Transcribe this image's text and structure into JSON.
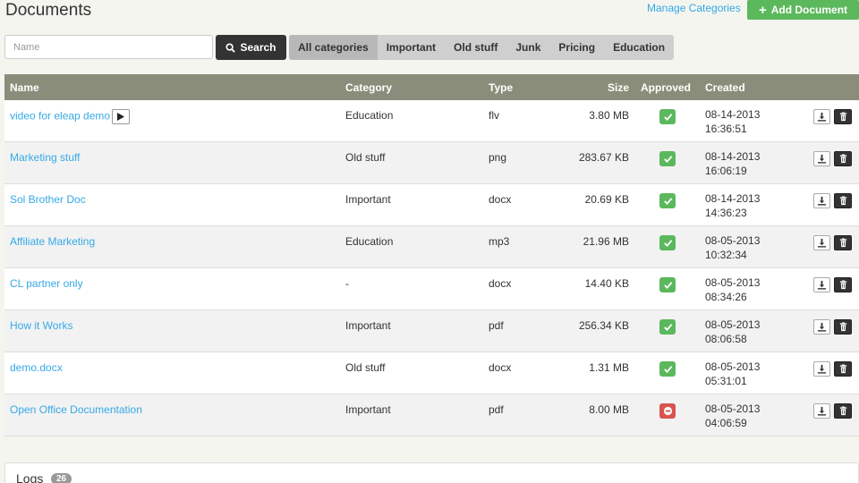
{
  "header": {
    "title": "Documents",
    "manage_link": "Manage Categories",
    "add_button": "Add Document"
  },
  "search": {
    "placeholder": "Name",
    "value": "",
    "button": "Search"
  },
  "categories": [
    {
      "label": "All categories",
      "active": true
    },
    {
      "label": "Important",
      "active": false
    },
    {
      "label": "Old stuff",
      "active": false
    },
    {
      "label": "Junk",
      "active": false
    },
    {
      "label": "Pricing",
      "active": false
    },
    {
      "label": "Education",
      "active": false
    }
  ],
  "table": {
    "columns": {
      "name": "Name",
      "category": "Category",
      "type": "Type",
      "size": "Size",
      "approved": "Approved",
      "created": "Created"
    },
    "rows": [
      {
        "name": "video for eleap demo",
        "category": "Education",
        "type": "flv",
        "size": "3.80 MB",
        "approved": true,
        "date": "08-14-2013",
        "time": "16:36:51",
        "play": true
      },
      {
        "name": "Marketing stuff",
        "category": "Old stuff",
        "type": "png",
        "size": "283.67 KB",
        "approved": true,
        "date": "08-14-2013",
        "time": "16:06:19",
        "play": false
      },
      {
        "name": "Sol Brother Doc",
        "category": "Important",
        "type": "docx",
        "size": "20.69 KB",
        "approved": true,
        "date": "08-14-2013",
        "time": "14:36:23",
        "play": false
      },
      {
        "name": "Affiliate Marketing",
        "category": "Education",
        "type": "mp3",
        "size": "21.96 MB",
        "approved": true,
        "date": "08-05-2013",
        "time": "10:32:34",
        "play": false
      },
      {
        "name": "CL partner only",
        "category": "-",
        "type": "docx",
        "size": "14.40 KB",
        "approved": true,
        "date": "08-05-2013",
        "time": "08:34:26",
        "play": false
      },
      {
        "name": "How it Works",
        "category": "Important",
        "type": "pdf",
        "size": "256.34 KB",
        "approved": true,
        "date": "08-05-2013",
        "time": "08:06:58",
        "play": false
      },
      {
        "name": "demo.docx",
        "category": "Old stuff",
        "type": "docx",
        "size": "1.31 MB",
        "approved": true,
        "date": "08-05-2013",
        "time": "05:31:01",
        "play": false
      },
      {
        "name": "Open Office Documentation",
        "category": "Important",
        "type": "pdf",
        "size": "8.00 MB",
        "approved": false,
        "date": "08-05-2013",
        "time": "04:06:59",
        "play": false
      }
    ]
  },
  "logs": {
    "title": "Logs",
    "count": "26"
  },
  "colors": {
    "accent_green": "#5cb85c",
    "link_blue": "#35a9e6",
    "header_gray": "#8b8d7b",
    "rejected_red": "#d9534f"
  },
  "icons": {
    "add": "plus-icon",
    "search": "magnifier-icon",
    "play": "play-icon",
    "approved": "check-icon",
    "rejected": "minus-circle-icon",
    "download": "download-icon",
    "delete": "trash-icon"
  }
}
